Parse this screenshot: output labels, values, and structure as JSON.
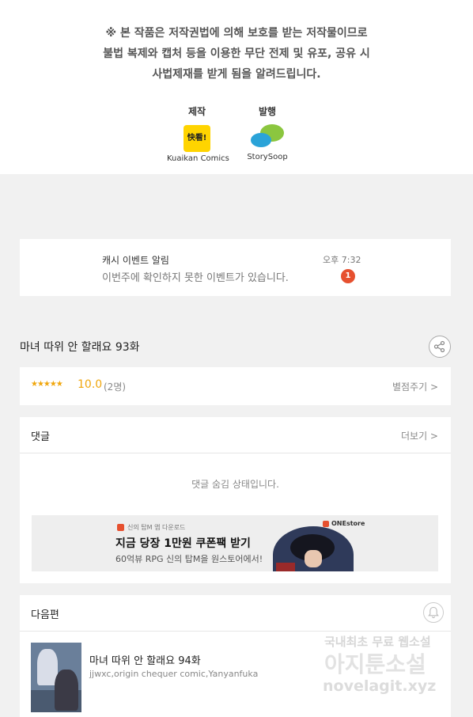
{
  "notice": {
    "line1": "※ 본 작품은 저작권법에 의해 보호를 받는 저작물이므로",
    "line2": "불법 복제와 캡처 등을 이용한 무단 전제 및 유포, 공유 시",
    "line3": "사법제재를 받게 됨을 알려드립니다."
  },
  "credits": {
    "production_label": "제작",
    "production_logo_text": "快看!",
    "production_name": "Kuaikan Comics",
    "publisher_label": "발행",
    "publisher_name": "StorySoop"
  },
  "event": {
    "title": "캐시 이벤트 알림",
    "description": "이번주에 확인하지 못한 이벤트가 있습니다.",
    "time": "오후 7:32",
    "badge": "1"
  },
  "episode": {
    "title": "마녀 따위 안 할래요 93화",
    "share_icon": "share-icon"
  },
  "rating": {
    "stars": "★★★★★",
    "score": "10.0",
    "count": "(2명)",
    "rate_link": "별점주기 >"
  },
  "comments": {
    "title": "댓글",
    "more_link": "더보기 >",
    "hidden_message": "댓글 숨김 상태입니다."
  },
  "ad": {
    "small_text": "신의 탑M 앱 다운로드",
    "headline": "지금 당장 1만원 쿠폰팩 받기",
    "subtext": "60억뷰 RPG 신의 탑M을 원스토어에서!",
    "store_logo": "ONEstore"
  },
  "next": {
    "section_title": "다음편",
    "bell_icon": "bell-icon",
    "episode_title": "마녀 따위 안 할래요 94화",
    "authors": "jjwxc,origin chequer comic,Yanyanfuka"
  },
  "watermark": {
    "line1": "국내최초 무료 웹소설",
    "line2": "아지툰소설",
    "line3": "novelagit.xyz"
  },
  "colors": {
    "accent_orange": "#f0a60c",
    "badge_red": "#e6502f",
    "background": "#f1f1f1"
  }
}
